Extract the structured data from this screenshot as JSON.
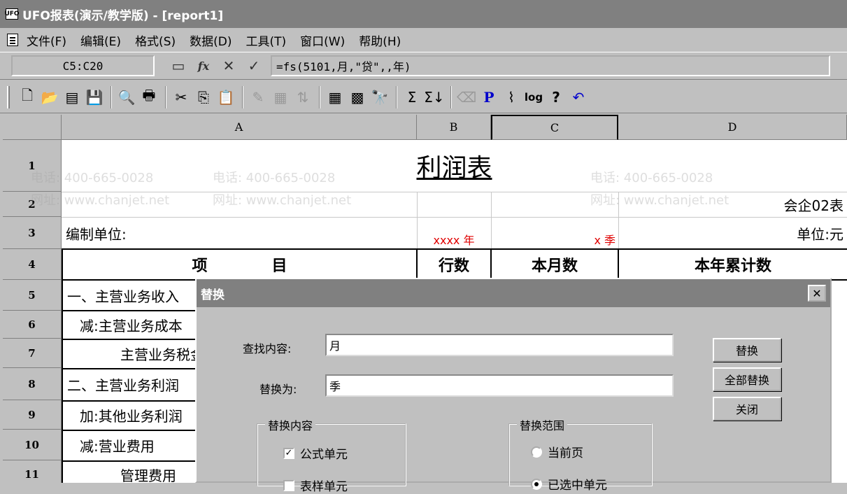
{
  "window": {
    "title": "UFO报表(演示/教学版) - [report1]",
    "icon_label": "UFO"
  },
  "menu": [
    "文件(F)",
    "编辑(E)",
    "格式(S)",
    "数据(D)",
    "工具(T)",
    "窗口(W)",
    "帮助(H)"
  ],
  "formula_bar": {
    "cell_ref": "C5:C20",
    "formula": "=fs(5101,月,\"贷\",,年)",
    "fx_label": "fx",
    "cancel_label": "✕",
    "confirm_label": "✓"
  },
  "toolbar": {
    "p_label": "P",
    "log_label": "log",
    "help_label": "?"
  },
  "sheet": {
    "columns": [
      "A",
      "B",
      "C",
      "D"
    ],
    "rows": [
      "1",
      "2",
      "3",
      "4",
      "5",
      "6",
      "7",
      "8",
      "9",
      "10",
      "11"
    ],
    "title": "利润表",
    "form_code": "会企02表",
    "prepared_by": "编制单位:",
    "unit": "单位:元",
    "year_placeholder": "xxxx 年",
    "quarter_placeholder": "x 季",
    "headers": {
      "item": "项            目",
      "line_no": "行数",
      "this_month": "本月数",
      "ytd": "本年累计数"
    },
    "row_items": [
      "一、主营业务收入",
      "减:主营业务成本",
      "主营业务税金",
      "二、主营业务利润",
      "加:其他业务利润",
      "减:营业费用",
      "管理费用"
    ]
  },
  "dialog": {
    "title": "替换",
    "find_label": "查找内容:",
    "find_value": "月",
    "replace_label": "替换为:",
    "replace_value": "季",
    "btn_replace": "替换",
    "btn_replace_all": "全部替换",
    "btn_close": "关闭",
    "content_group": "替换内容",
    "opt_formula": "公式单元",
    "opt_formula_checked": true,
    "opt_second": "表样单元",
    "scope_group": "替换范围",
    "scope_current": "当前页",
    "scope_selected": "已选中单元",
    "scope_selected_checked": true
  },
  "watermark": {
    "phone": "电话: 400-665-0028",
    "site": "网址: www.chanjet.net"
  }
}
